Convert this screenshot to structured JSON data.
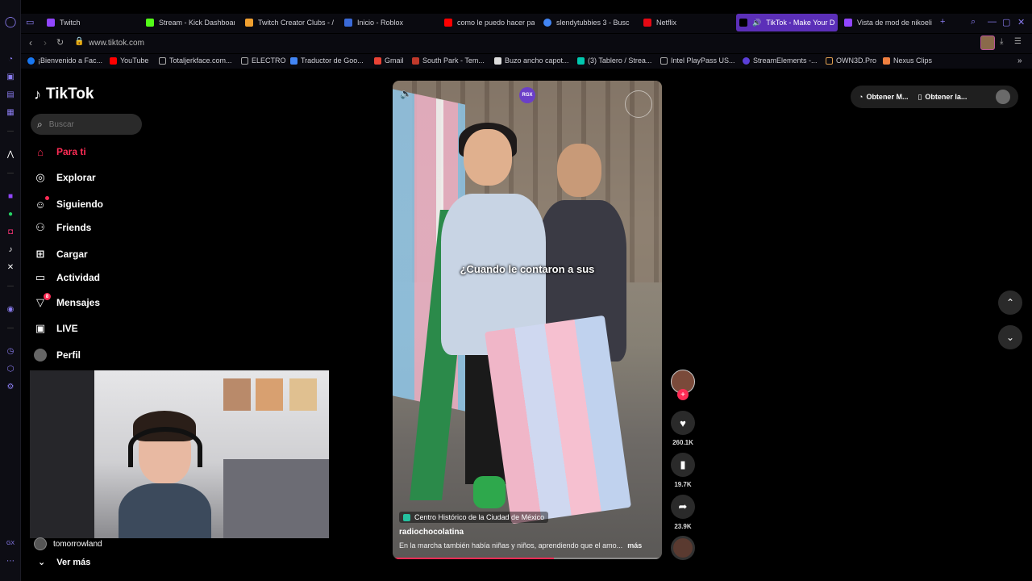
{
  "browser": {
    "tabs": [
      {
        "label": "Twitch",
        "color": "#9146ff"
      },
      {
        "label": "Stream - Kick Dashboar",
        "color": "#53fc18"
      },
      {
        "label": "Twitch Creator Clubs - /",
        "color": "#f0a030"
      },
      {
        "label": "Inicio - Roblox",
        "color": "#3a6ad8"
      },
      {
        "label": "como le puedo hacer pa",
        "color": "#ff0000"
      },
      {
        "label": "slendytubbies 3 - Busc",
        "color": "#4285f4"
      },
      {
        "label": "Netflix",
        "color": "#e50914"
      },
      {
        "label": "TikTok - Make Your D",
        "color": "#000000",
        "active": true
      },
      {
        "label": "Vista de mod de nikoeli",
        "color": "#9146ff"
      }
    ],
    "url": "www.tiktok.com",
    "bookmarks": [
      "¡Bienvenido a Fac...",
      "YouTube",
      "Totaljerkface.com...",
      "ELECTRO",
      "Traductor de Goo...",
      "Gmail",
      "South Park - Tem...",
      "Buzo ancho capot...",
      "(3) Tablero / Strea...",
      "Intel PlayPass US...",
      "StreamElements -...",
      "OWN3D.Pro",
      "Nexus Clips"
    ]
  },
  "tiktok": {
    "logo": "TikTok",
    "search_placeholder": "Buscar",
    "nav": [
      {
        "label": "Para ti",
        "icon": "home-icon",
        "active": true
      },
      {
        "label": "Explorar",
        "icon": "compass-icon"
      },
      {
        "label": "Siguiendo",
        "icon": "following-icon",
        "dot": true
      },
      {
        "label": "Friends",
        "icon": "friends-icon"
      },
      {
        "label": "Cargar",
        "icon": "upload-icon"
      },
      {
        "label": "Actividad",
        "icon": "activity-icon"
      },
      {
        "label": "Mensajes",
        "icon": "messages-icon",
        "badge": "8"
      },
      {
        "label": "LIVE",
        "icon": "live-icon"
      },
      {
        "label": "Perfil",
        "icon": "profile-icon"
      }
    ],
    "following_account": "tomorrowland",
    "see_more": "Ver más",
    "video": {
      "caption_overlay": "¿Cuando le contaron a sus",
      "rgx_badge": "RGX",
      "location": "Centro Histórico de la Ciudad de México",
      "author": "radiochocolatina",
      "description": "En la marcha también había niñas y niños, aprendiendo que el amo...",
      "more_label": "más",
      "progress_fraction": 0.6
    },
    "actions": {
      "likes": "260.1K",
      "saves": "19.7K",
      "shares": "23.9K"
    },
    "top_right": {
      "get_coins": "Obtener M...",
      "get_app": "Obtener la..."
    },
    "colors": {
      "accent": "#fe2c55",
      "browser_active_tab": "#5b2fb8"
    }
  }
}
